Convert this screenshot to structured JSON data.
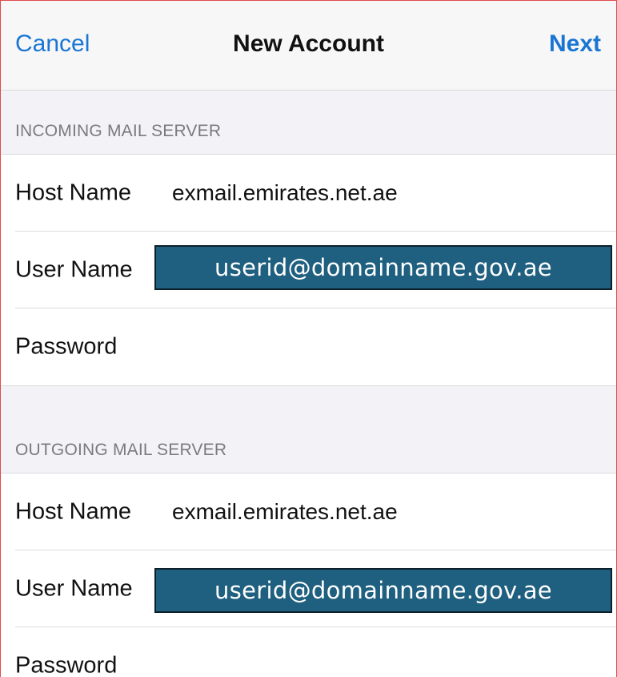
{
  "navbar": {
    "cancel_label": "Cancel",
    "title": "New Account",
    "next_label": "Next"
  },
  "incoming": {
    "header": "INCOMING MAIL SERVER",
    "host_label": "Host Name",
    "host_value": "exmail.emirates.net.ae",
    "user_label": "User Name",
    "user_overlay": "userid@domainname.gov.ae",
    "password_label": "Password"
  },
  "outgoing": {
    "header": "OUTGOING MAIL SERVER",
    "host_label": "Host Name",
    "host_value": "exmail.emirates.net.ae",
    "user_label": "User Name",
    "user_overlay": "userid@domainname.gov.ae",
    "password_label": "Password"
  },
  "colors": {
    "accent": "#1a76d2",
    "overlay_fill": "#1f5f7f",
    "page_background": "#f2f2f7"
  }
}
